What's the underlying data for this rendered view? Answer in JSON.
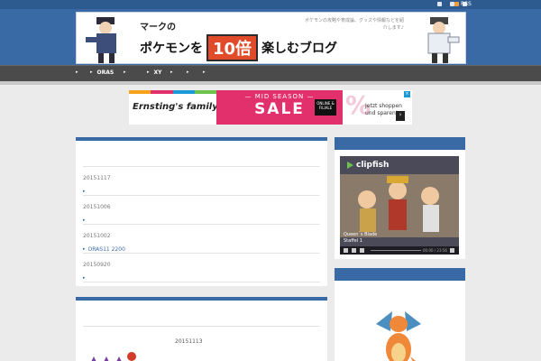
{
  "header": {
    "rss_label": "RSS",
    "banner_small": "マークの",
    "banner_main_left": "ポケモンを",
    "banner_main_ten": "10倍",
    "banner_main_right": "楽しむブログ",
    "banner_sub": "ポケモンの攻略や育成論、グッズや情報などを紹介します♪"
  },
  "nav": {
    "items": [
      "",
      "ORAS",
      "",
      "XY",
      "",
      ""
    ]
  },
  "ad": {
    "brand": "Ernsting's family",
    "mid": "— MID SEASON —",
    "sale": "SALE",
    "badge": "ONLINE & FILIALE",
    "pct": "%",
    "cta": "Jetzt shoppen und sparen!",
    "go": "›",
    "close": "×"
  },
  "posts": [
    {
      "date": "20151117",
      "title": ""
    },
    {
      "date": "20151006",
      "title": ""
    },
    {
      "date": "20151002",
      "title": "ORAS11 2200"
    },
    {
      "date": "20150920",
      "title": ""
    }
  ],
  "featured": {
    "date": "20151113"
  },
  "sidebar": {
    "video_brand": "clipfish",
    "video_caption": "Queen`s Blade\nStaffel 1",
    "video_time": "00:00 / 23:56"
  },
  "colors": {
    "accent": "#3a6aa5",
    "nav_bg": "#4b4b4b",
    "sale_pink": "#e1306c"
  }
}
